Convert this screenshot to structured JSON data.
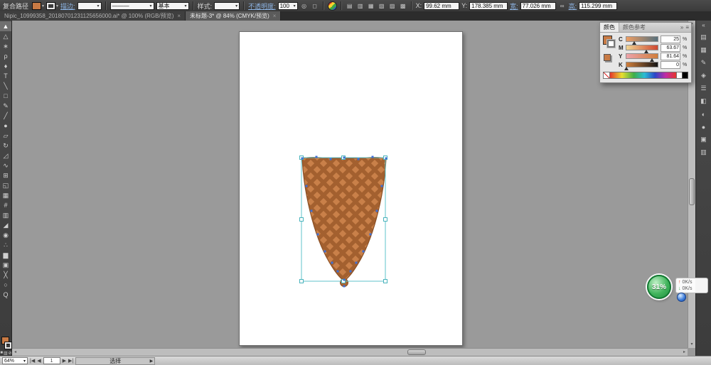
{
  "control_bar": {
    "selection_label": "复合路径",
    "stroke_label": "描边:",
    "brush_basic": "基本",
    "style_label": "样式:",
    "opacity_label": "不透明度:",
    "opacity_value": "100",
    "x_label": "X:",
    "x_value": "99.62 mm",
    "y_label": "Y:",
    "y_value": "178.385 mm",
    "w_label": "宽:",
    "w_value": "77.026 mm",
    "h_label": "高:",
    "h_value": "115.299 mm"
  },
  "tabs": [
    {
      "label": "Nipic_10999358_20180701231125656000.ai* @ 100% (RGB/预览)",
      "close": "×"
    },
    {
      "label": "未标题-3* @ 84% (CMYK/预览)",
      "close": "×"
    }
  ],
  "tools": [
    {
      "name": "selection-tool",
      "glyph": "▲",
      "active": true
    },
    {
      "name": "direct-selection-tool",
      "glyph": "△"
    },
    {
      "name": "magic-wand-tool",
      "glyph": "∗"
    },
    {
      "name": "lasso-tool",
      "glyph": "ρ"
    },
    {
      "name": "pen-tool",
      "glyph": "♦"
    },
    {
      "name": "type-tool",
      "glyph": "T"
    },
    {
      "name": "line-segment-tool",
      "glyph": "╲"
    },
    {
      "name": "rectangle-tool",
      "glyph": "□"
    },
    {
      "name": "paintbrush-tool",
      "glyph": "✎"
    },
    {
      "name": "pencil-tool",
      "glyph": "╱"
    },
    {
      "name": "blob-brush-tool",
      "glyph": "●"
    },
    {
      "name": "eraser-tool",
      "glyph": "▱"
    },
    {
      "name": "rotate-tool",
      "glyph": "↻"
    },
    {
      "name": "scale-tool",
      "glyph": "◿"
    },
    {
      "name": "width-tool",
      "glyph": "∿"
    },
    {
      "name": "free-transform-tool",
      "glyph": "⊞"
    },
    {
      "name": "shape-builder-tool",
      "glyph": "◱"
    },
    {
      "name": "perspective-grid-tool",
      "glyph": "▦"
    },
    {
      "name": "mesh-tool",
      "glyph": "#"
    },
    {
      "name": "gradient-tool",
      "glyph": "▥"
    },
    {
      "name": "eyedropper-tool",
      "glyph": "◢"
    },
    {
      "name": "blend-tool",
      "glyph": "◉"
    },
    {
      "name": "symbol-sprayer-tool",
      "glyph": "∴"
    },
    {
      "name": "column-graph-tool",
      "glyph": "▆"
    },
    {
      "name": "artboard-tool",
      "glyph": "▣"
    },
    {
      "name": "slice-tool",
      "glyph": "╳"
    },
    {
      "name": "hand-tool",
      "glyph": "○"
    },
    {
      "name": "zoom-tool",
      "glyph": "Q"
    }
  ],
  "dock_icons": [
    {
      "name": "color-panel-icon",
      "glyph": "▤"
    },
    {
      "name": "swatches-panel-icon",
      "glyph": "▦"
    },
    {
      "name": "brushes-panel-icon",
      "glyph": "✎"
    },
    {
      "name": "symbols-panel-icon",
      "glyph": "◈"
    },
    {
      "name": "stroke-panel-icon",
      "glyph": "☰"
    },
    {
      "name": "gradient-panel-icon",
      "glyph": "◧"
    },
    {
      "name": "transparency-panel-icon",
      "glyph": "◐"
    },
    {
      "name": "appearance-panel-icon",
      "glyph": "●"
    },
    {
      "name": "layers-panel-icon",
      "glyph": "▣"
    },
    {
      "name": "artboards-panel-icon",
      "glyph": "▥"
    }
  ],
  "color_panel": {
    "tab_color": "颜色",
    "tab_guide": "颜色参考",
    "rows": [
      {
        "ch": "C",
        "value": "25",
        "unit": "%"
      },
      {
        "ch": "M",
        "value": "63.67",
        "unit": "%"
      },
      {
        "ch": "Y",
        "value": "81.64",
        "unit": "%"
      },
      {
        "ch": "K",
        "value": "0",
        "unit": "%"
      }
    ]
  },
  "status_bar": {
    "zoom": "64%",
    "artboard": "1",
    "tool": "选择"
  },
  "download_widget": {
    "percent": "31%",
    "up_speed": "0K/s",
    "down_speed": "0K/s"
  },
  "glyphs": {
    "dropdown": "▾",
    "line_preview": "———",
    "constrain": "∞",
    "mask1": "◎",
    "mask2": "◻",
    "align": [
      "▤",
      "▥",
      "▦",
      "▧",
      "▨",
      "▩"
    ],
    "collapse_left": "«",
    "collapse_right": "»",
    "panel_menu": "≡",
    "nav_first": "|◀",
    "nav_prev": "◀",
    "nav_next": "▶",
    "nav_last": "▶|",
    "play": "▶",
    "up": "↑",
    "down": "↓",
    "none": "⊘",
    "mini_color": "■",
    "mini_gradient": "▥"
  },
  "artwork": {
    "description": "selected waffle ice-cream cone with lattice pattern",
    "fill": "#c98049",
    "stripe": "#a3602f",
    "selection_color": "#5fc3cb",
    "anchor_color": "#3d6fd6"
  }
}
